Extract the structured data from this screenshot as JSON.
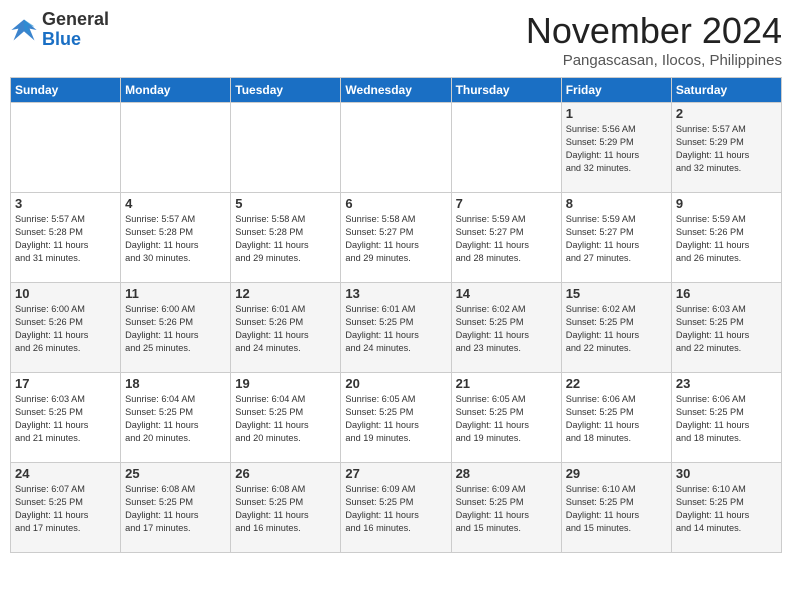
{
  "header": {
    "logo_general": "General",
    "logo_blue": "Blue",
    "month_title": "November 2024",
    "location": "Pangascasan, Ilocos, Philippines"
  },
  "days_of_week": [
    "Sunday",
    "Monday",
    "Tuesday",
    "Wednesday",
    "Thursday",
    "Friday",
    "Saturday"
  ],
  "weeks": [
    [
      {
        "day": "",
        "info": ""
      },
      {
        "day": "",
        "info": ""
      },
      {
        "day": "",
        "info": ""
      },
      {
        "day": "",
        "info": ""
      },
      {
        "day": "",
        "info": ""
      },
      {
        "day": "1",
        "info": "Sunrise: 5:56 AM\nSunset: 5:29 PM\nDaylight: 11 hours\nand 32 minutes."
      },
      {
        "day": "2",
        "info": "Sunrise: 5:57 AM\nSunset: 5:29 PM\nDaylight: 11 hours\nand 32 minutes."
      }
    ],
    [
      {
        "day": "3",
        "info": "Sunrise: 5:57 AM\nSunset: 5:28 PM\nDaylight: 11 hours\nand 31 minutes."
      },
      {
        "day": "4",
        "info": "Sunrise: 5:57 AM\nSunset: 5:28 PM\nDaylight: 11 hours\nand 30 minutes."
      },
      {
        "day": "5",
        "info": "Sunrise: 5:58 AM\nSunset: 5:28 PM\nDaylight: 11 hours\nand 29 minutes."
      },
      {
        "day": "6",
        "info": "Sunrise: 5:58 AM\nSunset: 5:27 PM\nDaylight: 11 hours\nand 29 minutes."
      },
      {
        "day": "7",
        "info": "Sunrise: 5:59 AM\nSunset: 5:27 PM\nDaylight: 11 hours\nand 28 minutes."
      },
      {
        "day": "8",
        "info": "Sunrise: 5:59 AM\nSunset: 5:27 PM\nDaylight: 11 hours\nand 27 minutes."
      },
      {
        "day": "9",
        "info": "Sunrise: 5:59 AM\nSunset: 5:26 PM\nDaylight: 11 hours\nand 26 minutes."
      }
    ],
    [
      {
        "day": "10",
        "info": "Sunrise: 6:00 AM\nSunset: 5:26 PM\nDaylight: 11 hours\nand 26 minutes."
      },
      {
        "day": "11",
        "info": "Sunrise: 6:00 AM\nSunset: 5:26 PM\nDaylight: 11 hours\nand 25 minutes."
      },
      {
        "day": "12",
        "info": "Sunrise: 6:01 AM\nSunset: 5:26 PM\nDaylight: 11 hours\nand 24 minutes."
      },
      {
        "day": "13",
        "info": "Sunrise: 6:01 AM\nSunset: 5:25 PM\nDaylight: 11 hours\nand 24 minutes."
      },
      {
        "day": "14",
        "info": "Sunrise: 6:02 AM\nSunset: 5:25 PM\nDaylight: 11 hours\nand 23 minutes."
      },
      {
        "day": "15",
        "info": "Sunrise: 6:02 AM\nSunset: 5:25 PM\nDaylight: 11 hours\nand 22 minutes."
      },
      {
        "day": "16",
        "info": "Sunrise: 6:03 AM\nSunset: 5:25 PM\nDaylight: 11 hours\nand 22 minutes."
      }
    ],
    [
      {
        "day": "17",
        "info": "Sunrise: 6:03 AM\nSunset: 5:25 PM\nDaylight: 11 hours\nand 21 minutes."
      },
      {
        "day": "18",
        "info": "Sunrise: 6:04 AM\nSunset: 5:25 PM\nDaylight: 11 hours\nand 20 minutes."
      },
      {
        "day": "19",
        "info": "Sunrise: 6:04 AM\nSunset: 5:25 PM\nDaylight: 11 hours\nand 20 minutes."
      },
      {
        "day": "20",
        "info": "Sunrise: 6:05 AM\nSunset: 5:25 PM\nDaylight: 11 hours\nand 19 minutes."
      },
      {
        "day": "21",
        "info": "Sunrise: 6:05 AM\nSunset: 5:25 PM\nDaylight: 11 hours\nand 19 minutes."
      },
      {
        "day": "22",
        "info": "Sunrise: 6:06 AM\nSunset: 5:25 PM\nDaylight: 11 hours\nand 18 minutes."
      },
      {
        "day": "23",
        "info": "Sunrise: 6:06 AM\nSunset: 5:25 PM\nDaylight: 11 hours\nand 18 minutes."
      }
    ],
    [
      {
        "day": "24",
        "info": "Sunrise: 6:07 AM\nSunset: 5:25 PM\nDaylight: 11 hours\nand 17 minutes."
      },
      {
        "day": "25",
        "info": "Sunrise: 6:08 AM\nSunset: 5:25 PM\nDaylight: 11 hours\nand 17 minutes."
      },
      {
        "day": "26",
        "info": "Sunrise: 6:08 AM\nSunset: 5:25 PM\nDaylight: 11 hours\nand 16 minutes."
      },
      {
        "day": "27",
        "info": "Sunrise: 6:09 AM\nSunset: 5:25 PM\nDaylight: 11 hours\nand 16 minutes."
      },
      {
        "day": "28",
        "info": "Sunrise: 6:09 AM\nSunset: 5:25 PM\nDaylight: 11 hours\nand 15 minutes."
      },
      {
        "day": "29",
        "info": "Sunrise: 6:10 AM\nSunset: 5:25 PM\nDaylight: 11 hours\nand 15 minutes."
      },
      {
        "day": "30",
        "info": "Sunrise: 6:10 AM\nSunset: 5:25 PM\nDaylight: 11 hours\nand 14 minutes."
      }
    ]
  ]
}
